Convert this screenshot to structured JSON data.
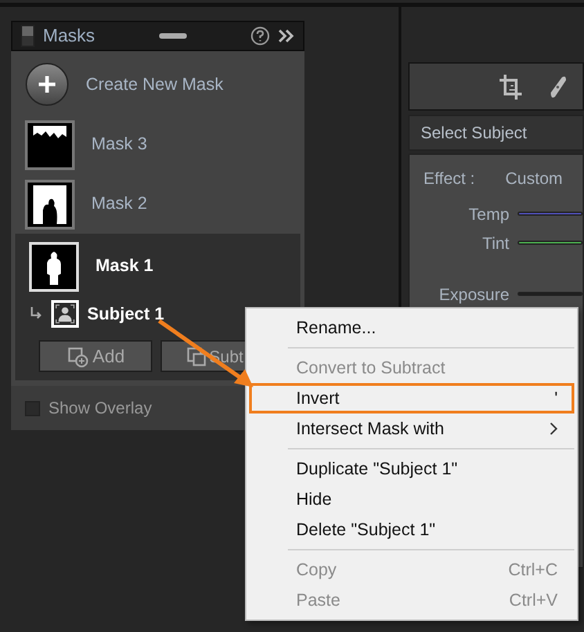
{
  "masks_panel": {
    "title": "Masks",
    "create_label": "Create New Mask",
    "masks": [
      {
        "name": "Mask 3",
        "kind": "trees",
        "selected": false
      },
      {
        "name": "Mask 2",
        "kind": "couple",
        "selected": false
      },
      {
        "name": "Mask 1",
        "kind": "person",
        "selected": true,
        "children": [
          {
            "name": "Subject 1",
            "kind": "subject"
          }
        ]
      }
    ],
    "buttons": [
      {
        "label": "Add",
        "kind": "add"
      },
      {
        "label": "Subt",
        "kind": "subtract"
      }
    ],
    "show_overlay": {
      "label": "Show Overlay",
      "checked": false
    }
  },
  "adjust_panel": {
    "section_title": "Select Subject",
    "effect": {
      "label": "Effect :",
      "value": "Custom"
    },
    "sliders": [
      {
        "name": "Temp",
        "color": "#5050b8"
      },
      {
        "name": "Tint",
        "color": "#4caf50"
      },
      {
        "name": "Exposure",
        "color": "#1e1e1e"
      }
    ]
  },
  "context_menu": {
    "items": [
      {
        "kind": "item",
        "label": "Rename...",
        "disabled": false,
        "highlighted": false
      },
      {
        "kind": "separator"
      },
      {
        "kind": "item",
        "label": "Convert to Subtract",
        "disabled": true,
        "highlighted": false
      },
      {
        "kind": "item",
        "label": "Invert",
        "shortcut": "'",
        "disabled": false,
        "highlighted": true
      },
      {
        "kind": "item",
        "label": "Intersect Mask with",
        "submenu": true,
        "disabled": false,
        "highlighted": false
      },
      {
        "kind": "separator"
      },
      {
        "kind": "item",
        "label": "Duplicate \"Subject 1\"",
        "disabled": false,
        "highlighted": false
      },
      {
        "kind": "item",
        "label": "Hide",
        "disabled": false,
        "highlighted": false
      },
      {
        "kind": "item",
        "label": "Delete \"Subject 1\"",
        "disabled": false,
        "highlighted": false
      },
      {
        "kind": "separator"
      },
      {
        "kind": "item",
        "label": "Copy",
        "shortcut": "Ctrl+C",
        "disabled": true,
        "highlighted": false
      },
      {
        "kind": "item",
        "label": "Paste",
        "shortcut": "Ctrl+V",
        "disabled": true,
        "highlighted": false
      }
    ]
  }
}
